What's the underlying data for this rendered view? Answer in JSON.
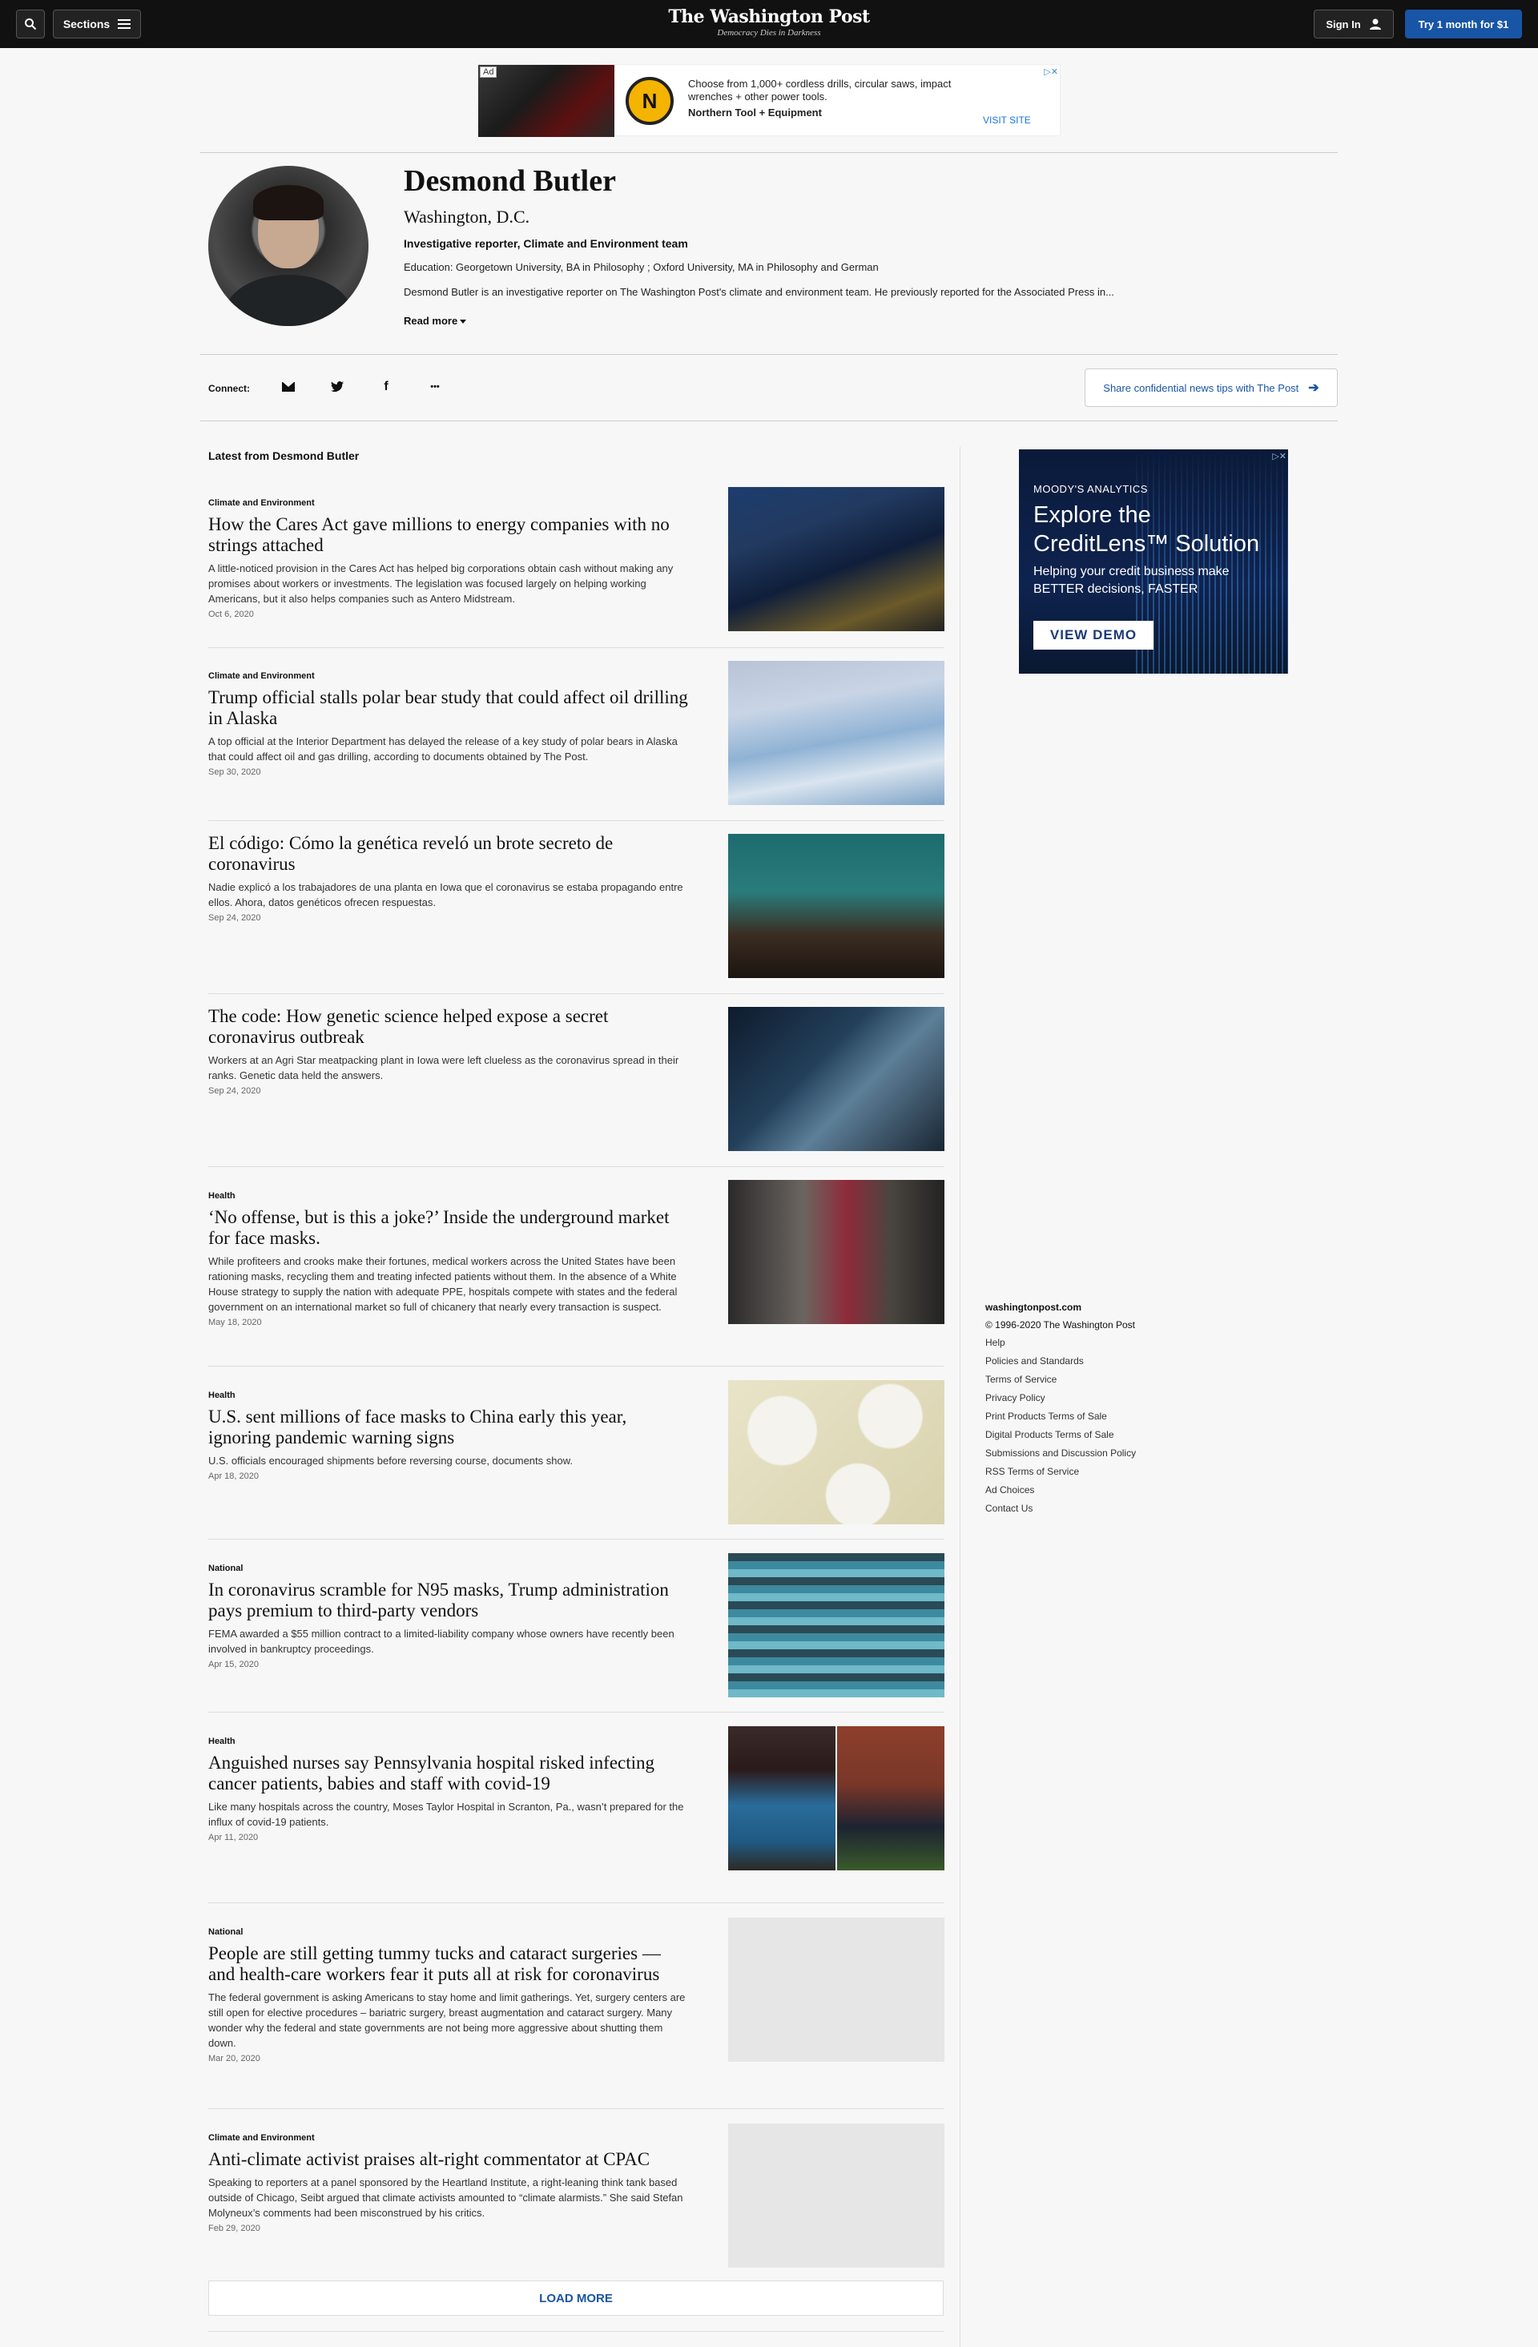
{
  "header": {
    "logo": "The Washington Post",
    "tagline": "Democracy Dies in Darkness",
    "sections_label": "Sections",
    "signin_label": "Sign In",
    "subscribe_label": "Try 1 month for $1"
  },
  "top_ad": {
    "badge": "Ad",
    "text": "Choose from 1,000+ cordless drills, circular saws, impact wrenches + other power tools.",
    "sponsor": "Northern Tool + Equipment",
    "cta": "VISIT SITE",
    "logo_letter": "N"
  },
  "profile": {
    "name": "Desmond Butler",
    "location": "Washington, D.C.",
    "role": "Investigative reporter, Climate and Environment team",
    "education": "Education: Georgetown University, BA in Philosophy ; Oxford University, MA in Philosophy and German",
    "bio": "Desmond Butler is an investigative reporter on The Washington Post's climate and environment team. He previously reported for the Associated Press in...",
    "read_more": "Read more"
  },
  "connect": {
    "label": "Connect:",
    "twitter_glyph": "🐦",
    "facebook_glyph": "f",
    "more_glyph": "•••",
    "tips_label": "Share confidential news tips with The Post"
  },
  "latest_title": "Latest from Desmond Butler",
  "articles": [
    {
      "kicker": "Climate and Environment",
      "headline": "How the Cares Act gave millions to energy companies with no strings attached",
      "blurb": "A little-noticed provision in the Cares Act has helped big corporations obtain cash without making any promises about workers or investments. The legislation was focused largely on helping working Americans, but it also helps companies such as Antero Midstream.",
      "date": "Oct 6, 2020"
    },
    {
      "kicker": "Climate and Environment",
      "headline": "Trump official stalls polar bear study that could affect oil drilling in Alaska",
      "blurb": "A top official at the Interior Department has delayed the release of a key study of polar bears in Alaska that could affect oil and gas drilling, according to documents obtained by The Post.",
      "date": "Sep 30, 2020"
    },
    {
      "kicker": "",
      "headline": "El código: Cómo la genética reveló un brote secreto de coronavirus",
      "blurb": "Nadie explicó a los trabajadores de una planta en Iowa que el coronavirus se estaba propagando entre ellos. Ahora, datos genéticos ofrecen respuestas.",
      "date": "Sep 24, 2020"
    },
    {
      "kicker": "",
      "headline": "The code: How genetic science helped expose a secret coronavirus outbreak",
      "blurb": "Workers at an Agri Star meatpacking plant in Iowa were left clueless as the coronavirus spread in their ranks. Genetic data held the answers.",
      "date": "Sep 24, 2020"
    },
    {
      "kicker": "Health",
      "headline": "‘No offense, but is this a joke?’ Inside the underground market for face masks.",
      "blurb": "While profiteers and crooks make their fortunes, medical workers across the United States have been rationing masks, recycling them and treating infected patients without them. In the absence of a White House strategy to supply the nation with adequate PPE, hospitals compete with states and the federal government on an international market so full of chicanery that nearly every transaction is suspect.",
      "date": "May 18, 2020"
    },
    {
      "kicker": "Health",
      "headline": "U.S. sent millions of face masks to China early this year, ignoring pandemic warning signs",
      "blurb": "U.S. officials encouraged shipments before reversing course, documents show.",
      "date": "Apr 18, 2020"
    },
    {
      "kicker": "National",
      "headline": "In coronavirus scramble for N95 masks, Trump administration pays premium to third-party vendors",
      "blurb": "FEMA awarded a $55 million contract to a limited-liability company whose owners have recently been involved in bankruptcy proceedings.",
      "date": "Apr 15, 2020"
    },
    {
      "kicker": "Health",
      "headline": "Anguished nurses say Pennsylvania hospital risked infecting cancer patients, babies and staff with covid-19",
      "blurb": "Like many hospitals across the country, Moses Taylor Hospital in Scranton, Pa., wasn’t prepared for the influx of covid-19 patients.",
      "date": "Apr 11, 2020"
    },
    {
      "kicker": "National",
      "headline": "People are still getting tummy tucks and cataract surgeries — and health-care workers fear it puts all at risk for coronavirus",
      "blurb": "The federal government is asking Americans to stay home and limit gatherings. Yet, surgery centers are still open for elective procedures – bariatric surgery, breast augmentation and cataract surgery. Many wonder why the federal and state governments are not being more aggressive about shutting them down.",
      "date": "Mar 20, 2020"
    },
    {
      "kicker": "Climate and Environment",
      "headline": "Anti-climate activist praises alt-right commentator at CPAC",
      "blurb": "Speaking to reporters at a panel sponsored by the Heartland Institute, a right-leaning think tank based outside of Chicago, Seibt argued that climate activists amounted to “climate alarmists.” She said Stefan Molyneux’s comments had been misconstrued by his critics.",
      "date": "Feb 29, 2020"
    }
  ],
  "load_more": "LOAD MORE",
  "side_ad": {
    "brand": "MOODY'S ANALYTICS",
    "headline": "Explore the CreditLens™ Solution",
    "sub": "Helping your credit business make BETTER decisions, FASTER",
    "cta": "VIEW DEMO"
  },
  "footer": {
    "site": "washingtonpost.com",
    "copyright": "© 1996-2020 The Washington Post",
    "links": [
      "Help",
      "Policies and Standards",
      "Terms of Service",
      "Privacy Policy",
      "Print Products Terms of Sale",
      "Digital Products Terms of Sale",
      "Submissions and Discussion Policy",
      "RSS Terms of Service",
      "Ad Choices",
      "Contact Us"
    ]
  },
  "colors": {
    "accent": "#1955a5",
    "nav_bg": "#111111",
    "page_bg": "#f7f7f7"
  }
}
